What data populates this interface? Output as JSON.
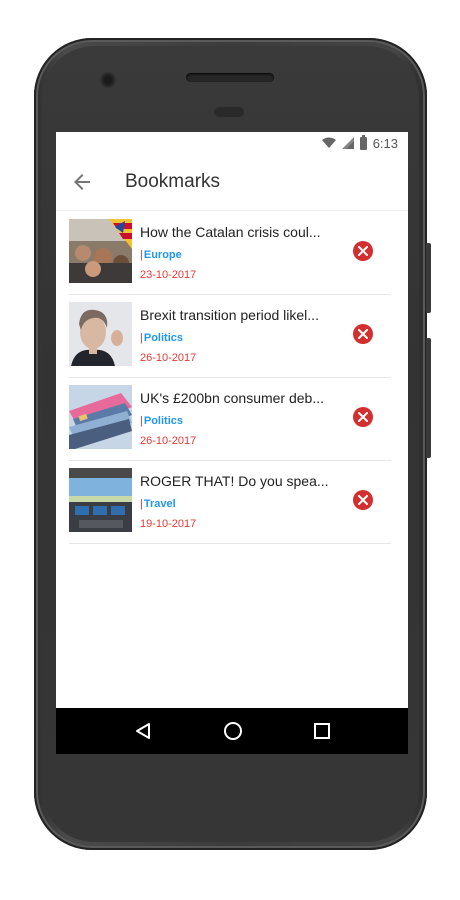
{
  "status": {
    "time": "6:13"
  },
  "app_bar": {
    "title": "Bookmarks"
  },
  "bookmarks": [
    {
      "title": "How the Catalan crisis coul...",
      "category": "Europe",
      "date": "23-10-2017",
      "category_color": "#2196f3"
    },
    {
      "title": "Brexit transition period likel...",
      "category": "Politics",
      "date": "26-10-2017",
      "category_color": "#2196f3"
    },
    {
      "title": "UK's £200bn consumer deb...",
      "category": "Politics",
      "date": "26-10-2017",
      "category_color": "#2196f3"
    },
    {
      "title": "ROGER THAT! Do you spea...",
      "category": "Travel",
      "date": "19-10-2017",
      "category_color": "#2196f3"
    }
  ],
  "colors": {
    "accent_red": "#e53935",
    "category_blue": "#2196f3",
    "remove_red": "#d32f2f"
  },
  "icons": {
    "back": "arrow-back-icon",
    "remove": "close-circle-icon",
    "nav_back": "triangle-back-icon",
    "nav_home": "circle-home-icon",
    "nav_recent": "square-recents-icon"
  }
}
